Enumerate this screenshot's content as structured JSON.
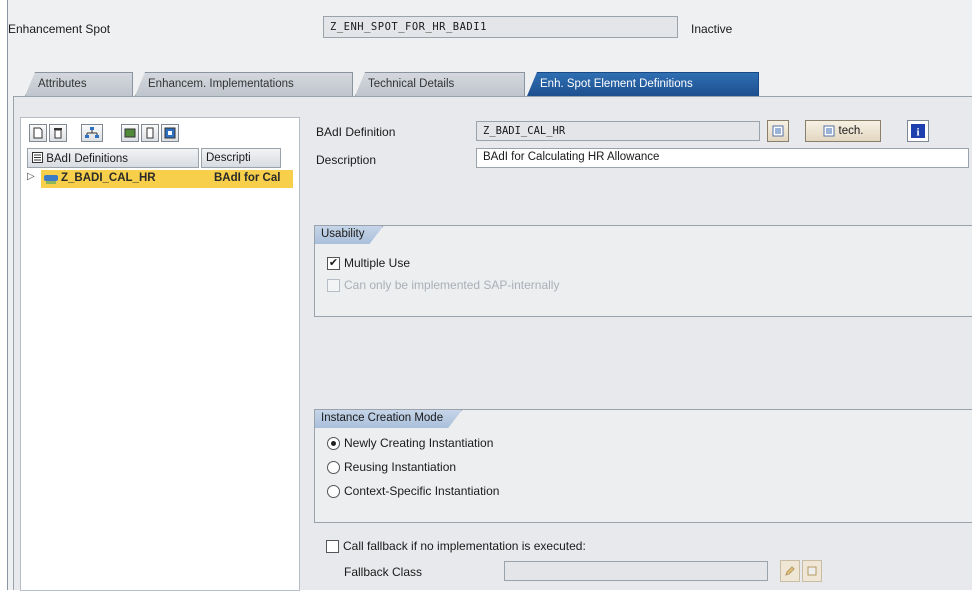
{
  "header": {
    "spot_label": "Enhancement Spot",
    "spot_value": "Z_ENH_SPOT_FOR_HR_BADI1",
    "status": "Inactive"
  },
  "tabs": [
    {
      "label": "Attributes",
      "active": false
    },
    {
      "label": "Enhancem. Implementations",
      "active": false
    },
    {
      "label": "Technical Details",
      "active": false
    },
    {
      "label": "Enh. Spot Element Definitions",
      "active": true
    }
  ],
  "tree": {
    "col_name": "BAdI Definitions",
    "col_desc": "Descripti",
    "rows": [
      {
        "name": "Z_BADI_CAL_HR",
        "desc": "BAdI for Cal"
      }
    ]
  },
  "detail": {
    "badi_def_label": "BAdI Definition",
    "badi_def_value": "Z_BADI_CAL_HR",
    "description_label": "Description",
    "description_value": "BAdI for Calculating HR Allowance",
    "tech_button": "tech."
  },
  "usability": {
    "title": "Usability",
    "multiple_use": "Multiple Use",
    "multiple_use_checked": true,
    "sap_internal": "Can only be implemented SAP-internally",
    "sap_internal_checked": false
  },
  "instance": {
    "title": "Instance Creation Mode",
    "options": [
      {
        "label": "Newly Creating Instantiation",
        "selected": true
      },
      {
        "label": "Reusing Instantiation",
        "selected": false
      },
      {
        "label": "Context-Specific Instantiation",
        "selected": false
      }
    ]
  },
  "fallback": {
    "call_label": "Call fallback if no implementation is executed:",
    "call_checked": false,
    "class_label": "Fallback Class",
    "class_value": ""
  }
}
